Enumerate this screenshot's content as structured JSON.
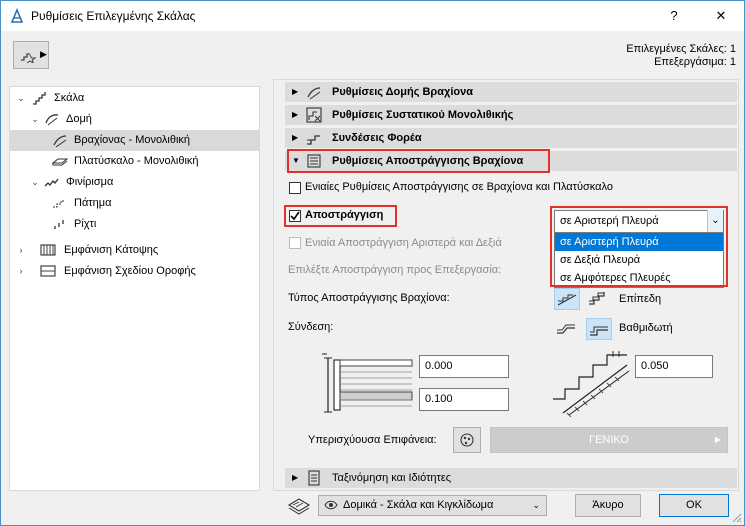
{
  "window": {
    "title": "Ρυθμίσεις Επιλεγμένης Σκάλας",
    "help_label": "?",
    "close_label": "✕"
  },
  "selection_info": {
    "selected_label": "Επιλεγμένες Σκάλες: 1",
    "editable_label": "Επεξεργάσιμα: 1"
  },
  "tree": {
    "items": [
      {
        "label": "Σκάλα"
      },
      {
        "label": "Δομή"
      },
      {
        "label": "Βραχίονας - Μονολιθική"
      },
      {
        "label": "Πλατύσκαλο - Μονολιθική"
      },
      {
        "label": "Φινίρισμα"
      },
      {
        "label": "Πάτημα"
      },
      {
        "label": "Ρίχτι"
      },
      {
        "label": "Εμφάνιση Κάτοψης"
      },
      {
        "label": "Εμφάνιση Σχεδίου Οροφής"
      }
    ]
  },
  "sections": {
    "s1": "Ρυθμίσεις Δομής Βραχίονα",
    "s2": "Ρυθμίσεις Συστατικού Μονολιθικής",
    "s3": "Συνδέσεις Φορέα",
    "s4": "Ρυθμίσεις Αποστράγγισης Βραχίονα",
    "s5": "Ταξινόμηση και Ιδιότητες"
  },
  "drainage": {
    "unified_label": "Ενιαίες Ρυθμίσεις Αποστράγγισης σε Βραχίονα και Πλατύσκαλο",
    "drainage_label": "Αποστράγγιση",
    "side_value": "σε Αριστερή Πλευρά",
    "side_options": [
      "σε Αριστερή Πλευρά",
      "σε Δεξιά Πλευρά",
      "σε Αμφότερες Πλευρές"
    ],
    "unified_lr_label": "Ενιαία Αποστράγγιση Αριστερά και Δεξιά",
    "choose_label": "Επιλέξτε Αποστράγγιση προς Επεξεργασία:",
    "type_label": "Τύπος Αποστράγγισης Βραχίονα:",
    "type_value": "Επίπεδη",
    "connection_label": "Σύνδεση:",
    "connection_value": "Βαθμιδωτή",
    "value_a": "0.000",
    "value_b": "0.100",
    "value_c": "0.050",
    "surface_label": "Υπερισχύουσα Επιφάνεια:",
    "surface_value": "ΓΕΝΙΚΟ"
  },
  "footer": {
    "layer_value": "Δομικά - Σκάλα και Κιγκλίδωμα",
    "cancel_label": "Άκυρο",
    "ok_label": "OK"
  },
  "colors": {
    "accent": "#0078d7",
    "highlight_box": "#e0312b",
    "section_bg": "#dcdcdc"
  }
}
